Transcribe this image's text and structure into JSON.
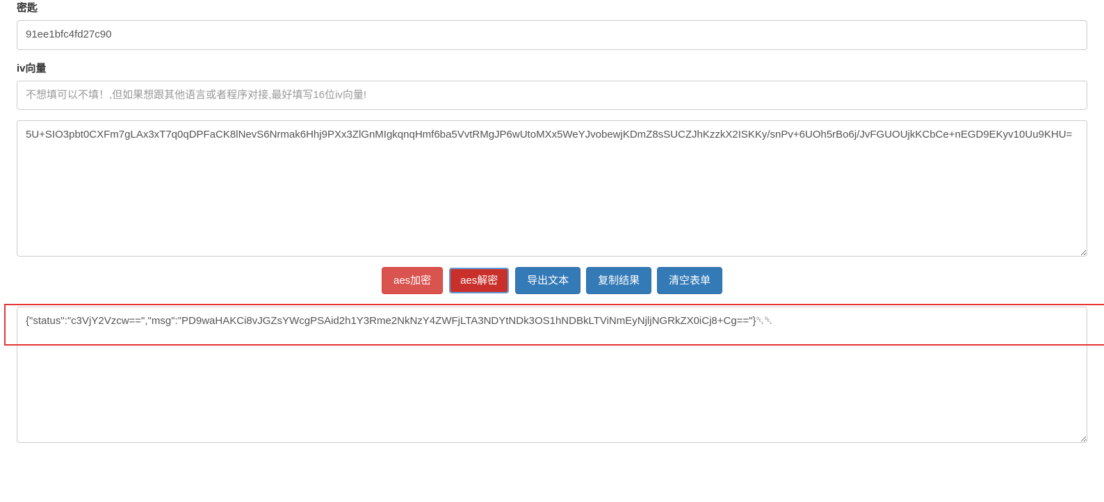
{
  "key_field": {
    "label": "密匙",
    "value": "91ee1bfc4fd27c90"
  },
  "iv_field": {
    "label": "iv向量",
    "value": "",
    "placeholder": "不想填可以不填！,但如果想跟其他语言或者程序对接,最好填写16位iv向量!"
  },
  "input_textarea": {
    "value": "5U+SIO3pbt0CXFm7gLAx3xT7q0qDPFaCK8lNevS6Nrmak6Hhj9PXx3ZlGnMIgkqnqHmf6ba5VvtRMgJP6wUtoMXx5WeYJvobewjKDmZ8sSUCZJhKzzkX2ISKKy/snPv+6UOh5rBo6j/JvFGUOUjkKCbCe+nEGD9EKyv10Uu9KHU="
  },
  "buttons": {
    "encrypt": "aes加密",
    "decrypt": "aes解密",
    "export": "导出文本",
    "copy": "复制结果",
    "clear": "清空表单"
  },
  "output_textarea": {
    "value": "{\"status\":\"c3VjY2Vzcw==\",\"msg\":\"PD9waHAKCi8vJGZsYWcgPSAid2h1Y3Rme2NkNzY4ZWFjLTA3NDYtNDk3OS1hNDBkLTViNmEyNjljNGRkZX0iCj8+Cg==\"}␡␡"
  }
}
